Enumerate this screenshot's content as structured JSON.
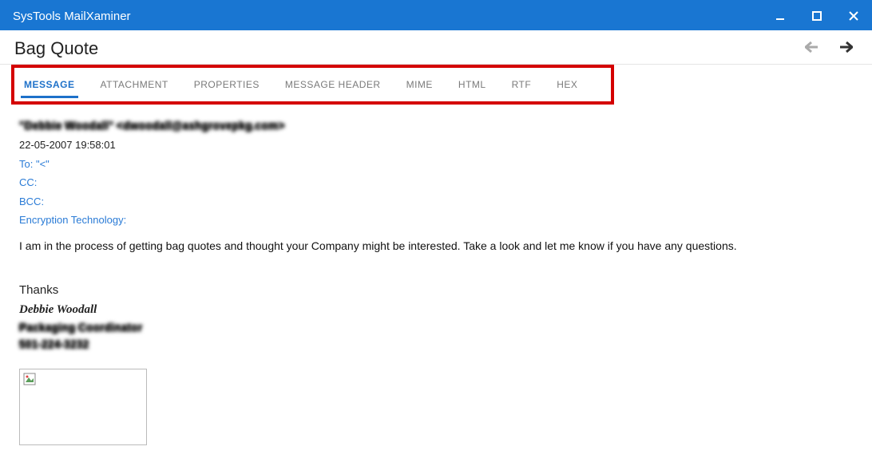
{
  "titlebar": {
    "app": "SysTools MailXaminer"
  },
  "subject": "Bag Quote",
  "tabs": [
    {
      "label": "MESSAGE",
      "active": true
    },
    {
      "label": "ATTACHMENT"
    },
    {
      "label": "PROPERTIES"
    },
    {
      "label": "MESSAGE HEADER"
    },
    {
      "label": "MIME"
    },
    {
      "label": "HTML"
    },
    {
      "label": "RTF"
    },
    {
      "label": "HEX"
    }
  ],
  "header": {
    "from_obf": "\"Debbie Woodall\" <dwoodall@ashgrovepkg.com>",
    "date": "22-05-2007 19:58:01",
    "to_label": "To:",
    "to_value": "\"<\"",
    "cc_label": "CC:",
    "bcc_label": "BCC:",
    "enc_label": "Encryption Technology:"
  },
  "message": {
    "body": "I am in the process of getting bag quotes and thought your Company might be interested. Take a look and let me know if you have any questions.",
    "thanks": "Thanks",
    "sig_name": "Debbie Woodall",
    "sig_title_obf": "Packaging Coordinator",
    "sig_phone_obf": "501-224-3232"
  }
}
